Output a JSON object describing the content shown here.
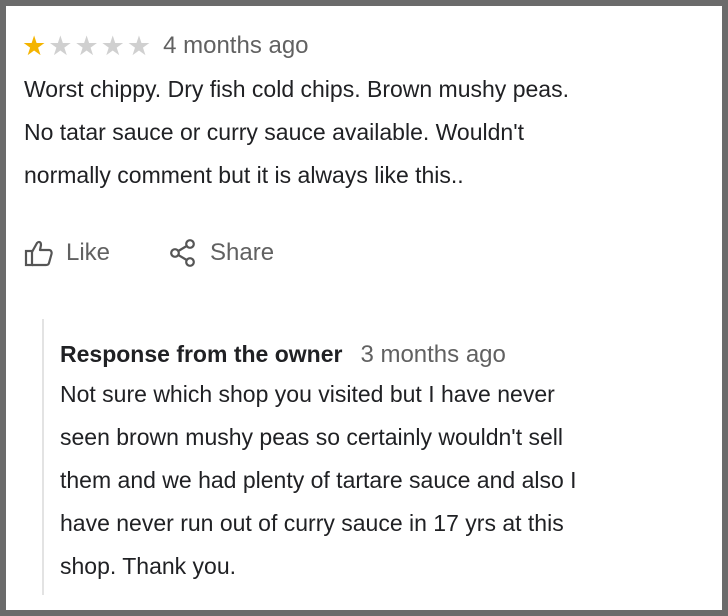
{
  "review": {
    "rating": 1,
    "max_rating": 5,
    "time": "4 months ago",
    "text": "Worst chippy. Dry fish cold chips. Brown mushy peas.\nNo tatar sauce or curry sauce available. Wouldn't\nnormally comment but it is always like this.."
  },
  "actions": {
    "like_label": "Like",
    "share_label": "Share"
  },
  "response": {
    "title": "Response from the owner",
    "time": "3 months ago",
    "text": "Not sure which shop you visited but I have never\nseen brown mushy peas so certainly wouldn't sell\nthem and we had plenty of tartare sauce and also I\nhave never run out of curry sauce in 17 yrs at this\nshop. Thank you."
  },
  "colors": {
    "star_on": "#f4b400",
    "star_off": "#d0d0d0",
    "muted_text": "#616161",
    "frame": "#6b6b6b"
  },
  "icons": [
    "star-icon",
    "thumbs-up-icon",
    "share-icon"
  ]
}
